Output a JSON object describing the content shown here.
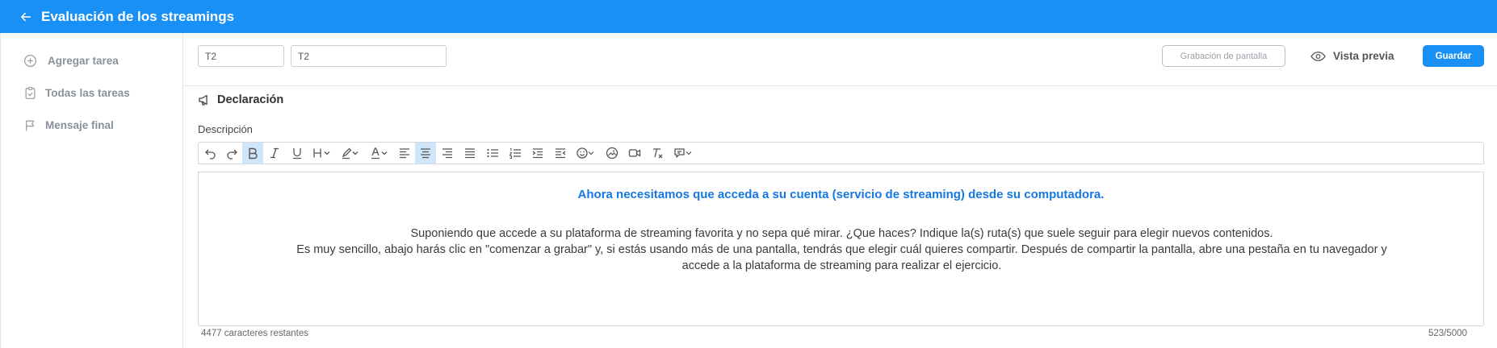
{
  "header": {
    "title": "Evaluación de los streamings"
  },
  "sidebar": {
    "items": [
      {
        "label": "Agregar tarea",
        "icon": "plus-circle-icon"
      },
      {
        "label": "Todas las tareas",
        "icon": "clipboard-check-icon"
      },
      {
        "label": "Mensaje final",
        "icon": "flag-icon"
      }
    ]
  },
  "task_header": {
    "short_name_value": "T2",
    "name_value": "T2",
    "screen_record_label": "Grabación de pantalla",
    "preview_label": "Vista previa",
    "save_label": "Guardar"
  },
  "section": {
    "title": "Declaración",
    "description_label": "Descripción"
  },
  "editor": {
    "toolbar": [
      "undo-icon",
      "redo-icon",
      "bold-icon",
      "italic-icon",
      "underline-icon",
      "heading-icon",
      "highlight-icon",
      "font-color-icon",
      "align-left-icon",
      "align-center-icon",
      "align-right-icon",
      "align-justify-icon",
      "bullet-list-icon",
      "numbered-list-icon",
      "indent-icon",
      "outdent-icon",
      "emoji-icon",
      "image-icon",
      "video-icon",
      "clear-format-icon",
      "comment-icon"
    ],
    "heading": "Ahora necesitamos que acceda a su cuenta (servicio de streaming) desde su computadora.",
    "paragraph1": "Suponiendo que accede a su plataforma de streaming favorita y no sepa qué mirar. ¿Que haces? Indique la(s) ruta(s) que suele seguir para elegir nuevos contenidos.",
    "paragraph2_line1": "Es muy sencillo, abajo harás clic en \"comenzar a grabar\" y, si estás usando más de una pantalla, tendrás que elegir cuál quieres compartir. Después de compartir la pantalla, abre una pestaña en tu navegador y",
    "paragraph2_line2": "accede a la plataforma de streaming para realizar el ejercicio."
  },
  "footer": {
    "remaining": "4477 caracteres restantes",
    "counter": "523/5000"
  },
  "colors": {
    "brand": "#1890f5",
    "heading_text": "#1677e0"
  }
}
